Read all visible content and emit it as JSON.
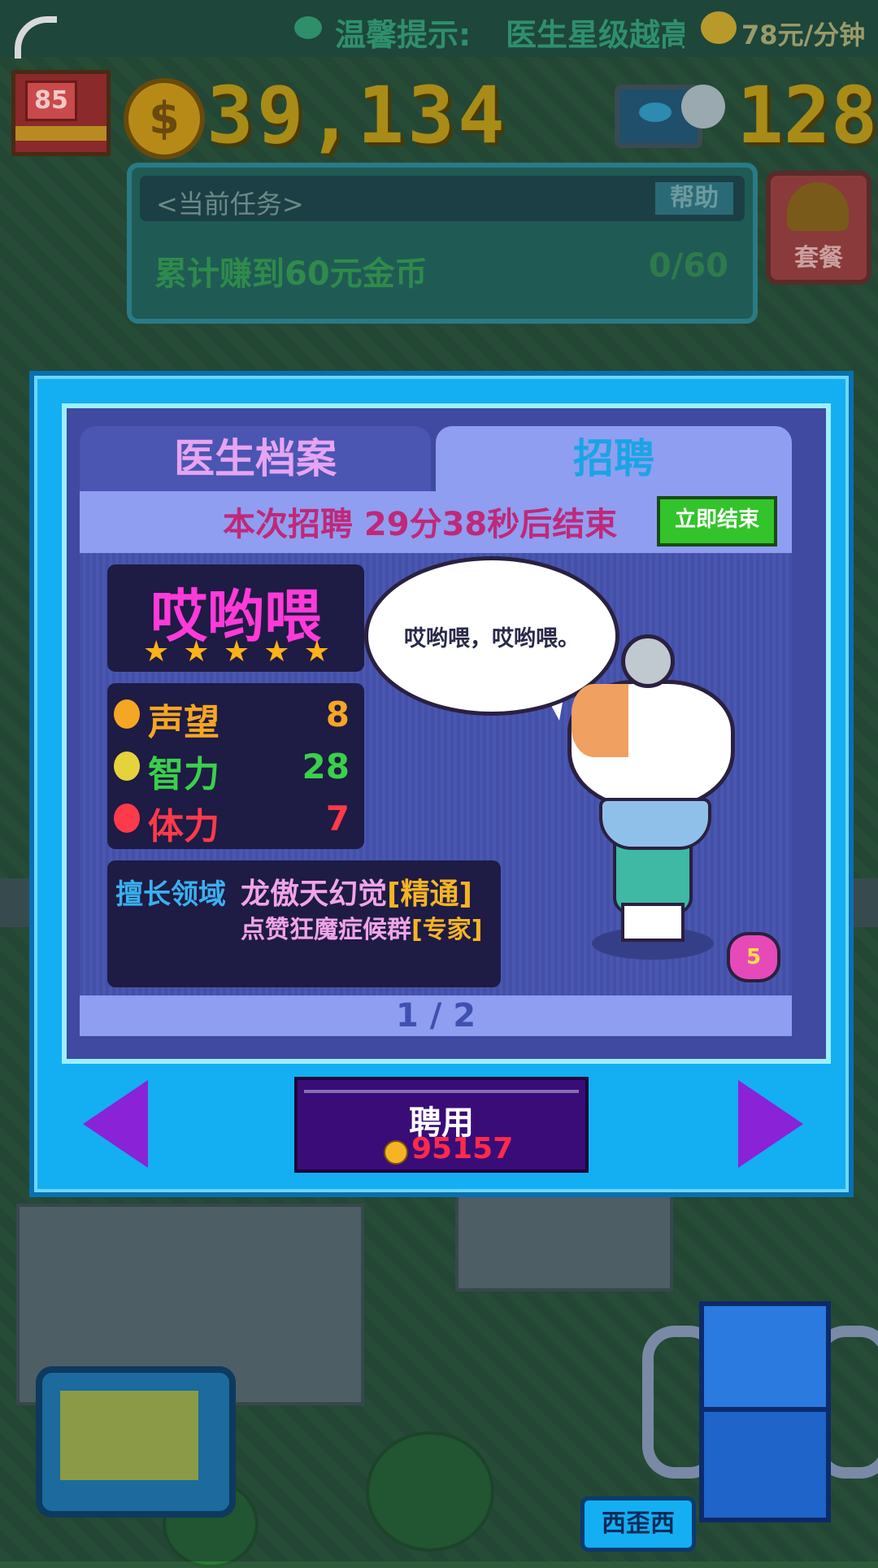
{
  "topbar": {
    "tip_label": "温馨提示:",
    "tip_text": "医生星级越高",
    "rate": "78元/分钟"
  },
  "resources": {
    "level": "85",
    "coins": "39,134",
    "coin_symbol": "$",
    "gems": "128"
  },
  "task": {
    "header": "<当前任务>",
    "help_label": "帮助",
    "description": "累计赚到60元金币",
    "progress": "0/60"
  },
  "meal_button": {
    "label": "套餐"
  },
  "dialog": {
    "tabs": [
      {
        "label": "医生档案",
        "active": false
      },
      {
        "label": "招聘",
        "active": true
      }
    ],
    "recruit_timer": "本次招聘 29分38秒后结束",
    "end_now_label": "立即结束",
    "doctor": {
      "name": "哎哟喂",
      "stars": 5,
      "speech": "哎哟喂，哎哟喂。",
      "stats": [
        {
          "label": "声望",
          "value": "8",
          "color": "#f5a623",
          "icon": "medal-icon"
        },
        {
          "label": "智力",
          "value": "28",
          "color": "#3ad04a",
          "icon": "lightbulb-icon"
        },
        {
          "label": "体力",
          "value": "7",
          "color": "#ff3a4a",
          "icon": "heart-icon"
        }
      ],
      "specialty_label": "擅长领域",
      "specialties": [
        {
          "name": "龙傲天幻觉",
          "level": "[精通]"
        },
        {
          "name": "点赞狂魔症候群",
          "level": "[专家]"
        }
      ],
      "badge_level": "5"
    },
    "page_indicator": "1 / 2",
    "hire": {
      "label": "聘用",
      "cost": "95157"
    }
  },
  "bottom": {
    "user_tag": "西歪西"
  },
  "colors": {
    "dialog_bg": "#14aef2",
    "panel_bg": "#3f4aa0",
    "accent_pink": "#ff3ad8",
    "accent_purple": "#8a22d8"
  }
}
